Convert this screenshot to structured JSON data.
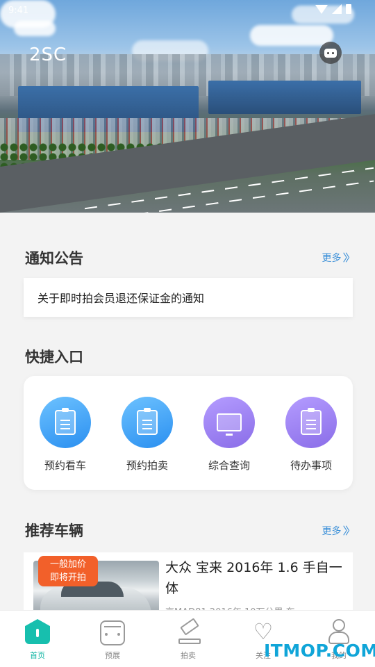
{
  "status_bar": {
    "time": "9:41"
  },
  "header": {
    "brand": "2SC",
    "message_icon": "chat-bubble-icon"
  },
  "notice": {
    "title": "通知公告",
    "more_label": "更多",
    "items": [
      {
        "text": "关于即时拍会员退还保证金的通知"
      }
    ]
  },
  "quick_entry": {
    "title": "快捷入口",
    "items": [
      {
        "label": "预约看车",
        "icon": "cart-clipboard-icon",
        "color": "#2a8ff0"
      },
      {
        "label": "预约拍卖",
        "icon": "auction-clipboard-icon",
        "color": "#2a8ff0"
      },
      {
        "label": "综合查询",
        "icon": "monitor-search-icon",
        "color": "#8a6de8"
      },
      {
        "label": "待办事项",
        "icon": "todo-clipboard-icon",
        "color": "#8a6de8"
      }
    ]
  },
  "recommended": {
    "title": "推荐车辆",
    "more_label": "更多",
    "cars": [
      {
        "tag_line1": "一般加价",
        "tag_line2": "即将开拍",
        "title": "大众 宝来 2016年 1.6 手自一体",
        "subtitle": "京MAD81 2016年 10万公里 车"
      }
    ]
  },
  "bottom_nav": {
    "items": [
      {
        "label": "首页",
        "icon": "home-icon",
        "active": true
      },
      {
        "label": "预展",
        "icon": "car-icon",
        "active": false
      },
      {
        "label": "拍卖",
        "icon": "gavel-icon",
        "active": false
      },
      {
        "label": "关注",
        "icon": "heart-icon",
        "active": false
      },
      {
        "label": "我的",
        "icon": "user-icon",
        "active": false
      }
    ]
  },
  "watermark": "ITMOP.COM",
  "colors": {
    "accent": "#16b7a5",
    "link": "#3a8fd8",
    "tag": "#f2602a",
    "blue_icon": "#2a8ff0",
    "purple_icon": "#8a6de8"
  }
}
